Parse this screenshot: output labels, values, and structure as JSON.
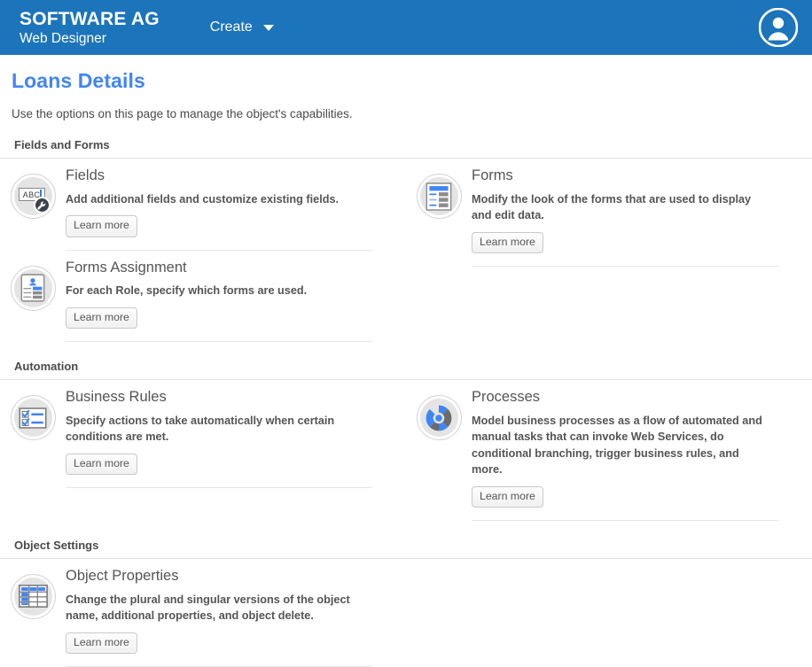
{
  "header": {
    "brand_line1": "SOFTWARE AG",
    "brand_line2": "Web Designer",
    "create_label": "Create",
    "avatar_name": "user-avatar",
    "bg_color": "#1c74bb"
  },
  "page": {
    "title": "Loans Details",
    "title_color": "#4285f4",
    "subtitle": "Use the options on this page to manage the object's capabilities."
  },
  "learn_more_label": "Learn more",
  "sections": [
    {
      "id": "fields-and-forms",
      "heading": "Fields and Forms",
      "left": [
        {
          "title": "Fields",
          "desc": "Add additional fields and customize existing fields.",
          "icon": "abc-text-field-wrench-icon",
          "button": "Learn more"
        },
        {
          "title": "Forms Assignment",
          "desc": "For each Role, specify which forms are used.",
          "icon": "id-badge-form-icon",
          "button": "Learn more"
        }
      ],
      "right": [
        {
          "title": "Forms",
          "desc": "Modify the look of the forms that are used to display and edit data.",
          "icon": "form-layout-icon",
          "button": "Learn more"
        }
      ]
    },
    {
      "id": "automation",
      "heading": "Automation",
      "left": [
        {
          "title": "Business Rules",
          "desc": "Specify actions to take automatically when certain conditions are met.",
          "icon": "checklist-rules-icon",
          "button": "Learn more"
        }
      ],
      "right": [
        {
          "title": "Processes",
          "desc": "Model business processes as a flow of automated and manual tasks that can invoke Web Services, do conditional branching, trigger business rules, and more.",
          "icon": "process-wheel-icon",
          "button": "Learn more"
        }
      ]
    },
    {
      "id": "object-settings",
      "heading": "Object Settings",
      "left": [
        {
          "title": "Object Properties",
          "desc": "Change the plural and singular versions of the object name, additional properties, and object delete.",
          "icon": "table-grid-icon",
          "button": "Learn more"
        }
      ],
      "right": []
    }
  ],
  "colors": {
    "accent_blue": "#4285f4",
    "icon_blue": "#3f86f5",
    "header_blue": "#1c74bb",
    "text_gray": "#555555",
    "divider": "#e6e6e6"
  }
}
